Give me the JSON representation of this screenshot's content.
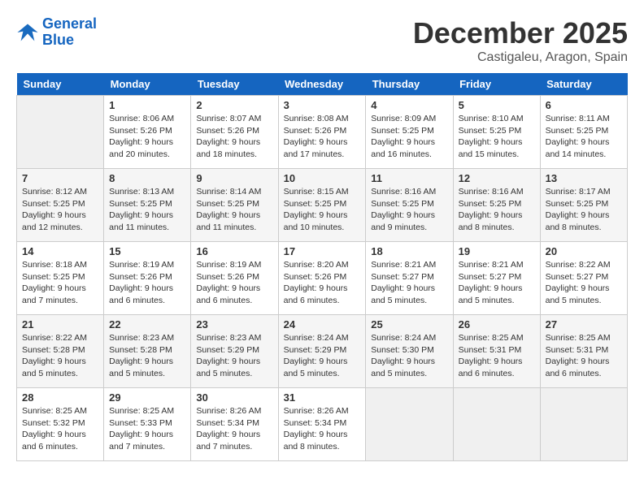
{
  "logo": {
    "line1": "General",
    "line2": "Blue"
  },
  "header": {
    "month": "December 2025",
    "location": "Castigaleu, Aragon, Spain"
  },
  "weekdays": [
    "Sunday",
    "Monday",
    "Tuesday",
    "Wednesday",
    "Thursday",
    "Friday",
    "Saturday"
  ],
  "weeks": [
    [
      {
        "day": "",
        "sunrise": "",
        "sunset": "",
        "daylight": ""
      },
      {
        "day": "1",
        "sunrise": "Sunrise: 8:06 AM",
        "sunset": "Sunset: 5:26 PM",
        "daylight": "Daylight: 9 hours and 20 minutes."
      },
      {
        "day": "2",
        "sunrise": "Sunrise: 8:07 AM",
        "sunset": "Sunset: 5:26 PM",
        "daylight": "Daylight: 9 hours and 18 minutes."
      },
      {
        "day": "3",
        "sunrise": "Sunrise: 8:08 AM",
        "sunset": "Sunset: 5:26 PM",
        "daylight": "Daylight: 9 hours and 17 minutes."
      },
      {
        "day": "4",
        "sunrise": "Sunrise: 8:09 AM",
        "sunset": "Sunset: 5:25 PM",
        "daylight": "Daylight: 9 hours and 16 minutes."
      },
      {
        "day": "5",
        "sunrise": "Sunrise: 8:10 AM",
        "sunset": "Sunset: 5:25 PM",
        "daylight": "Daylight: 9 hours and 15 minutes."
      },
      {
        "day": "6",
        "sunrise": "Sunrise: 8:11 AM",
        "sunset": "Sunset: 5:25 PM",
        "daylight": "Daylight: 9 hours and 14 minutes."
      }
    ],
    [
      {
        "day": "7",
        "sunrise": "Sunrise: 8:12 AM",
        "sunset": "Sunset: 5:25 PM",
        "daylight": "Daylight: 9 hours and 12 minutes."
      },
      {
        "day": "8",
        "sunrise": "Sunrise: 8:13 AM",
        "sunset": "Sunset: 5:25 PM",
        "daylight": "Daylight: 9 hours and 11 minutes."
      },
      {
        "day": "9",
        "sunrise": "Sunrise: 8:14 AM",
        "sunset": "Sunset: 5:25 PM",
        "daylight": "Daylight: 9 hours and 11 minutes."
      },
      {
        "day": "10",
        "sunrise": "Sunrise: 8:15 AM",
        "sunset": "Sunset: 5:25 PM",
        "daylight": "Daylight: 9 hours and 10 minutes."
      },
      {
        "day": "11",
        "sunrise": "Sunrise: 8:16 AM",
        "sunset": "Sunset: 5:25 PM",
        "daylight": "Daylight: 9 hours and 9 minutes."
      },
      {
        "day": "12",
        "sunrise": "Sunrise: 8:16 AM",
        "sunset": "Sunset: 5:25 PM",
        "daylight": "Daylight: 9 hours and 8 minutes."
      },
      {
        "day": "13",
        "sunrise": "Sunrise: 8:17 AM",
        "sunset": "Sunset: 5:25 PM",
        "daylight": "Daylight: 9 hours and 8 minutes."
      }
    ],
    [
      {
        "day": "14",
        "sunrise": "Sunrise: 8:18 AM",
        "sunset": "Sunset: 5:25 PM",
        "daylight": "Daylight: 9 hours and 7 minutes."
      },
      {
        "day": "15",
        "sunrise": "Sunrise: 8:19 AM",
        "sunset": "Sunset: 5:26 PM",
        "daylight": "Daylight: 9 hours and 6 minutes."
      },
      {
        "day": "16",
        "sunrise": "Sunrise: 8:19 AM",
        "sunset": "Sunset: 5:26 PM",
        "daylight": "Daylight: 9 hours and 6 minutes."
      },
      {
        "day": "17",
        "sunrise": "Sunrise: 8:20 AM",
        "sunset": "Sunset: 5:26 PM",
        "daylight": "Daylight: 9 hours and 6 minutes."
      },
      {
        "day": "18",
        "sunrise": "Sunrise: 8:21 AM",
        "sunset": "Sunset: 5:27 PM",
        "daylight": "Daylight: 9 hours and 5 minutes."
      },
      {
        "day": "19",
        "sunrise": "Sunrise: 8:21 AM",
        "sunset": "Sunset: 5:27 PM",
        "daylight": "Daylight: 9 hours and 5 minutes."
      },
      {
        "day": "20",
        "sunrise": "Sunrise: 8:22 AM",
        "sunset": "Sunset: 5:27 PM",
        "daylight": "Daylight: 9 hours and 5 minutes."
      }
    ],
    [
      {
        "day": "21",
        "sunrise": "Sunrise: 8:22 AM",
        "sunset": "Sunset: 5:28 PM",
        "daylight": "Daylight: 9 hours and 5 minutes."
      },
      {
        "day": "22",
        "sunrise": "Sunrise: 8:23 AM",
        "sunset": "Sunset: 5:28 PM",
        "daylight": "Daylight: 9 hours and 5 minutes."
      },
      {
        "day": "23",
        "sunrise": "Sunrise: 8:23 AM",
        "sunset": "Sunset: 5:29 PM",
        "daylight": "Daylight: 9 hours and 5 minutes."
      },
      {
        "day": "24",
        "sunrise": "Sunrise: 8:24 AM",
        "sunset": "Sunset: 5:29 PM",
        "daylight": "Daylight: 9 hours and 5 minutes."
      },
      {
        "day": "25",
        "sunrise": "Sunrise: 8:24 AM",
        "sunset": "Sunset: 5:30 PM",
        "daylight": "Daylight: 9 hours and 5 minutes."
      },
      {
        "day": "26",
        "sunrise": "Sunrise: 8:25 AM",
        "sunset": "Sunset: 5:31 PM",
        "daylight": "Daylight: 9 hours and 6 minutes."
      },
      {
        "day": "27",
        "sunrise": "Sunrise: 8:25 AM",
        "sunset": "Sunset: 5:31 PM",
        "daylight": "Daylight: 9 hours and 6 minutes."
      }
    ],
    [
      {
        "day": "28",
        "sunrise": "Sunrise: 8:25 AM",
        "sunset": "Sunset: 5:32 PM",
        "daylight": "Daylight: 9 hours and 6 minutes."
      },
      {
        "day": "29",
        "sunrise": "Sunrise: 8:25 AM",
        "sunset": "Sunset: 5:33 PM",
        "daylight": "Daylight: 9 hours and 7 minutes."
      },
      {
        "day": "30",
        "sunrise": "Sunrise: 8:26 AM",
        "sunset": "Sunset: 5:34 PM",
        "daylight": "Daylight: 9 hours and 7 minutes."
      },
      {
        "day": "31",
        "sunrise": "Sunrise: 8:26 AM",
        "sunset": "Sunset: 5:34 PM",
        "daylight": "Daylight: 9 hours and 8 minutes."
      },
      {
        "day": "",
        "sunrise": "",
        "sunset": "",
        "daylight": ""
      },
      {
        "day": "",
        "sunrise": "",
        "sunset": "",
        "daylight": ""
      },
      {
        "day": "",
        "sunrise": "",
        "sunset": "",
        "daylight": ""
      }
    ]
  ]
}
